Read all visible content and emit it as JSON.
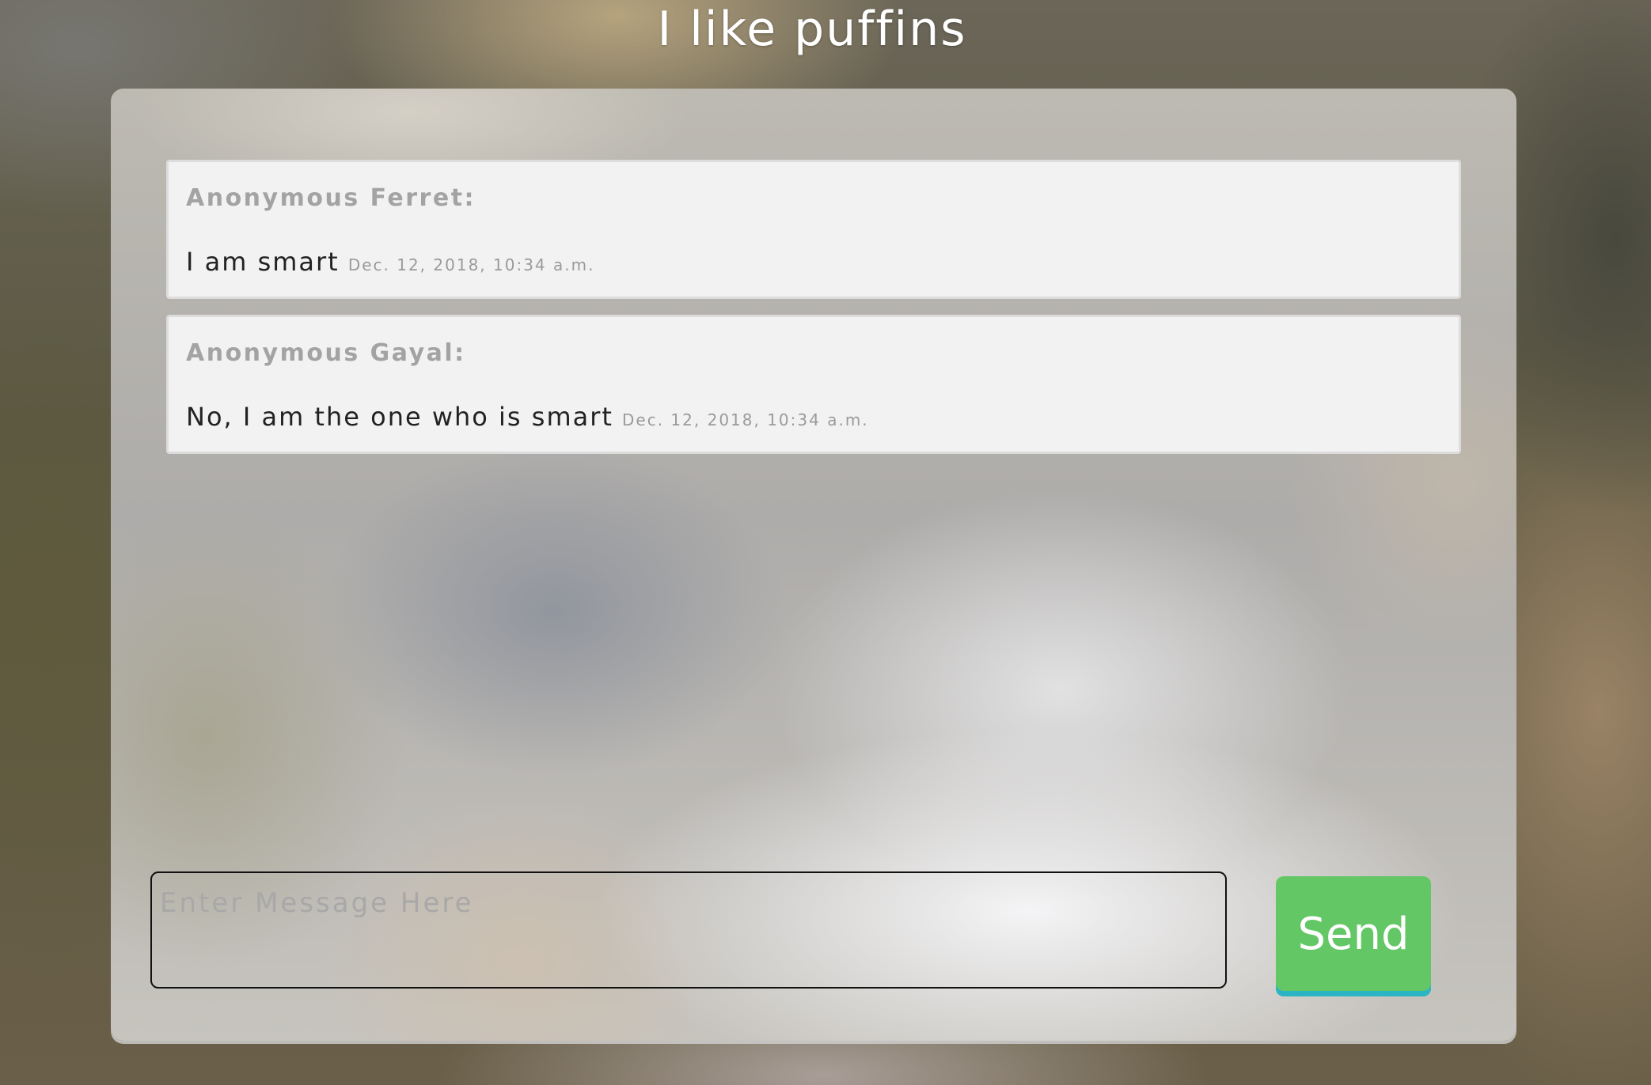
{
  "page": {
    "title": "I like puffins"
  },
  "messages": [
    {
      "author": "Anonymous Ferret:",
      "text": "I am smart",
      "timestamp": "Dec. 12, 2018, 10:34 a.m."
    },
    {
      "author": "Anonymous Gayal:",
      "text": "No, I am the one who is smart",
      "timestamp": "Dec. 12, 2018, 10:34 a.m."
    }
  ],
  "composer": {
    "placeholder": "Enter Message Here",
    "value": "",
    "send_label": "Send"
  },
  "colors": {
    "send_button": "#64c766",
    "send_button_underline": "#2bb5c4",
    "message_card": "#f2f2f2",
    "author_text": "#a3a3a3"
  }
}
